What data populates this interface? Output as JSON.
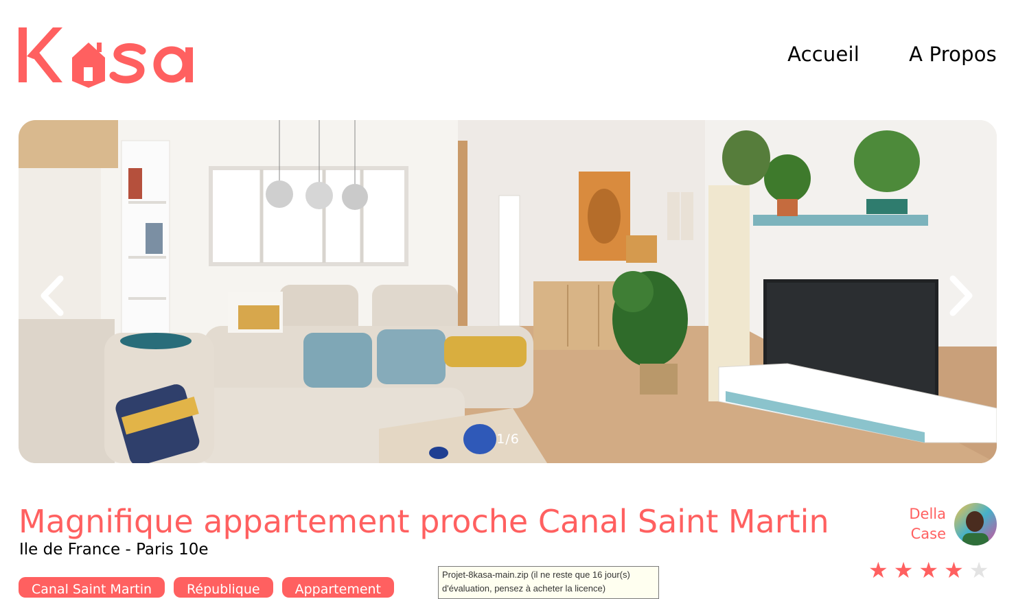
{
  "brand": {
    "logo_text": "Kasa",
    "color": "#FF6060"
  },
  "nav": {
    "items": [
      "Accueil",
      "A Propos"
    ]
  },
  "gallery": {
    "counter": "1/6",
    "prev_icon": "chevron-left-icon",
    "next_icon": "chevron-right-icon"
  },
  "listing": {
    "title": "Magnifique appartement proche Canal Saint Martin",
    "location": "Ile de France - Paris 10e",
    "tags": [
      "Canal Saint Martin",
      "République",
      "Appartement"
    ],
    "host": {
      "first_name": "Della",
      "last_name": "Case"
    },
    "rating": 4,
    "rating_max": 5,
    "star_active_color": "#FF6060",
    "star_inactive_color": "#E3E3E3"
  },
  "tooltip": {
    "line1": "Projet-8kasa-main.zip (il ne reste que 16 jour(s)",
    "line2": "d'évaluation, pensez à acheter la licence)"
  }
}
